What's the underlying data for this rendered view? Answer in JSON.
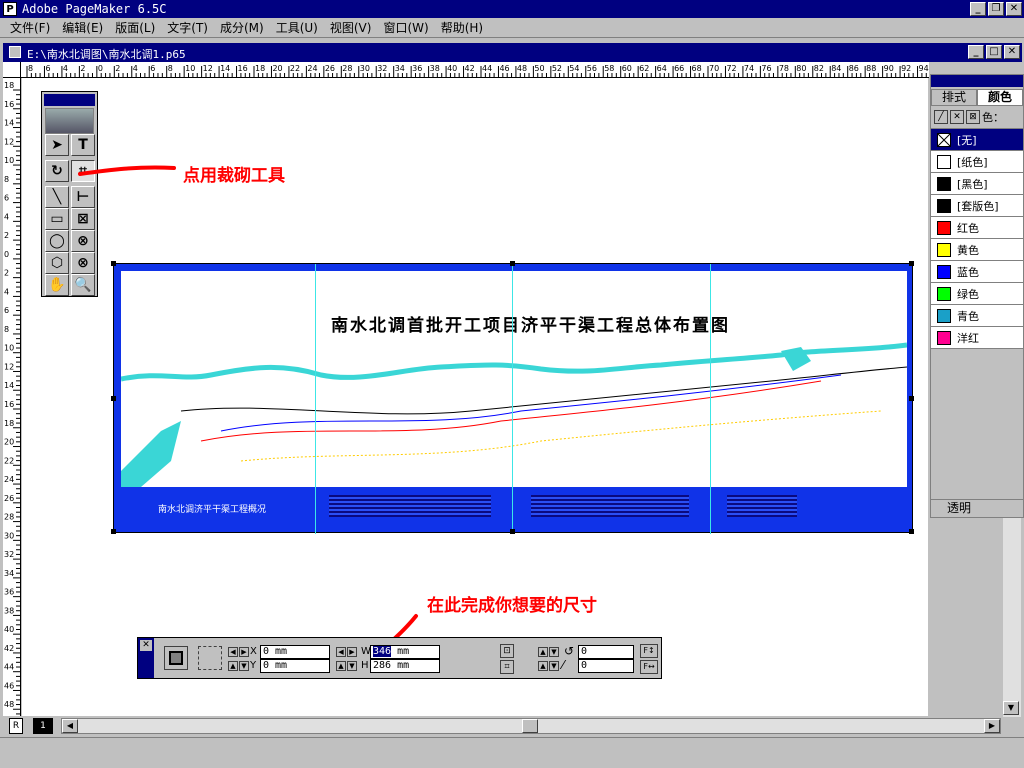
{
  "app": {
    "title": "Adobe PageMaker 6.5C",
    "icon_letter": "P"
  },
  "menu": [
    "文件(F)",
    "编辑(E)",
    "版面(L)",
    "文字(T)",
    "成分(M)",
    "工具(U)",
    "视图(V)",
    "窗口(W)",
    "帮助(H)"
  ],
  "document": {
    "title": "E:\\南水北调图\\南水北调1.p65"
  },
  "ruler": {
    "h_labels": [
      "8",
      "6",
      "4",
      "2",
      "0",
      "2",
      "4",
      "6",
      "8",
      "10",
      "12",
      "14",
      "16",
      "18",
      "20",
      "22",
      "24",
      "26",
      "28",
      "30",
      "32",
      "34",
      "36",
      "38",
      "40",
      "42",
      "44",
      "46",
      "48",
      "50",
      "52",
      "54",
      "56",
      "58",
      "60",
      "62",
      "64",
      "66",
      "68",
      "70",
      "72",
      "74",
      "76",
      "78",
      "80",
      "82",
      "84",
      "86",
      "88",
      "90",
      "92",
      "94"
    ],
    "v_labels": [
      "18",
      "16",
      "14",
      "12",
      "10",
      "8",
      "6",
      "4",
      "2",
      "0",
      "2",
      "4",
      "6",
      "8",
      "10",
      "12",
      "14",
      "16",
      "18",
      "20",
      "22",
      "24",
      "26",
      "28",
      "30",
      "32",
      "34",
      "36",
      "38",
      "40",
      "42",
      "44",
      "46",
      "48"
    ]
  },
  "annotations": {
    "crop_tool": "点用裁砌工具",
    "size_hint": "在此完成你想要的尺寸"
  },
  "map": {
    "title": "南水北调首批开工项目济平干渠工程总体布置图",
    "caption": "南水北调济平干渠工程概况"
  },
  "panel": {
    "tabs": [
      "排式",
      "颜色"
    ],
    "color_label": "色：",
    "colors": [
      {
        "name": "[无]",
        "color": "#ffffff",
        "selected": true
      },
      {
        "name": "[纸色]",
        "color": "#ffffff"
      },
      {
        "name": "[黑色]",
        "color": "#000000"
      },
      {
        "name": "[套版色]",
        "color": "#000000"
      },
      {
        "name": "红色",
        "color": "#ff0000"
      },
      {
        "name": "黄色",
        "color": "#ffff00"
      },
      {
        "name": "蓝色",
        "color": "#0000ff"
      },
      {
        "name": "绿色",
        "color": "#00ff00"
      },
      {
        "name": "青色",
        "color": "#1aa0c8"
      },
      {
        "name": "洋红",
        "color": "#ff0090"
      }
    ],
    "transparent_label": "透明"
  },
  "control": {
    "x_label": "X",
    "x_value": "0 mm",
    "y_label": "Y",
    "y_value": "0 mm",
    "w_label": "W",
    "w_value_selected": "346",
    "w_value_rest": " mm",
    "h_label": "H",
    "h_value": "286 mm",
    "rotate_value": "0",
    "skew_value": "0"
  },
  "pages": {
    "r_label": "R",
    "current": "1"
  }
}
